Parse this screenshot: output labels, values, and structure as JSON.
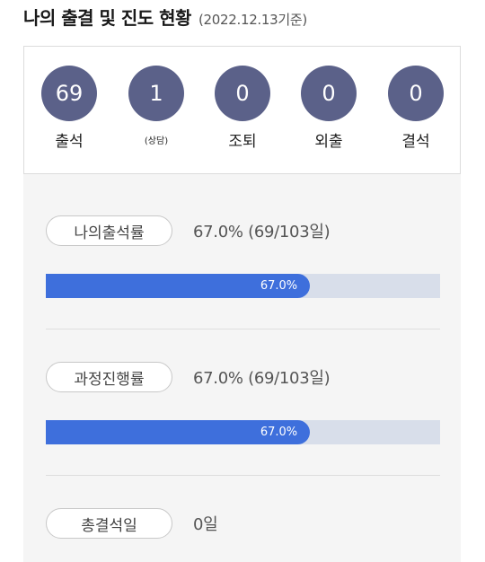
{
  "header": {
    "title": "나의 출결 및 진도 현황",
    "date": "(2022.12.13기준)"
  },
  "summary": {
    "items": [
      {
        "value": "69",
        "label": "출석"
      },
      {
        "value": "1",
        "label": "(상담)"
      },
      {
        "value": "0",
        "label": "조퇴"
      },
      {
        "value": "0",
        "label": "외출"
      },
      {
        "value": "0",
        "label": "결석"
      }
    ],
    "circle_color": "#5b6189"
  },
  "detail": {
    "attendance": {
      "label": "나의출석률",
      "value_text": "67.0% (69/103일)",
      "bar_text": "67.0%",
      "progress": 0.67
    },
    "progress": {
      "label": "과정진행률",
      "value_text": "67.0% (69/103일)",
      "bar_text": "67.0%",
      "progress": 0.67
    },
    "total_absence": {
      "label": "총결석일",
      "value_text": "0일"
    },
    "bar_color": "#3e6fdc",
    "track_color": "#d8deea"
  }
}
